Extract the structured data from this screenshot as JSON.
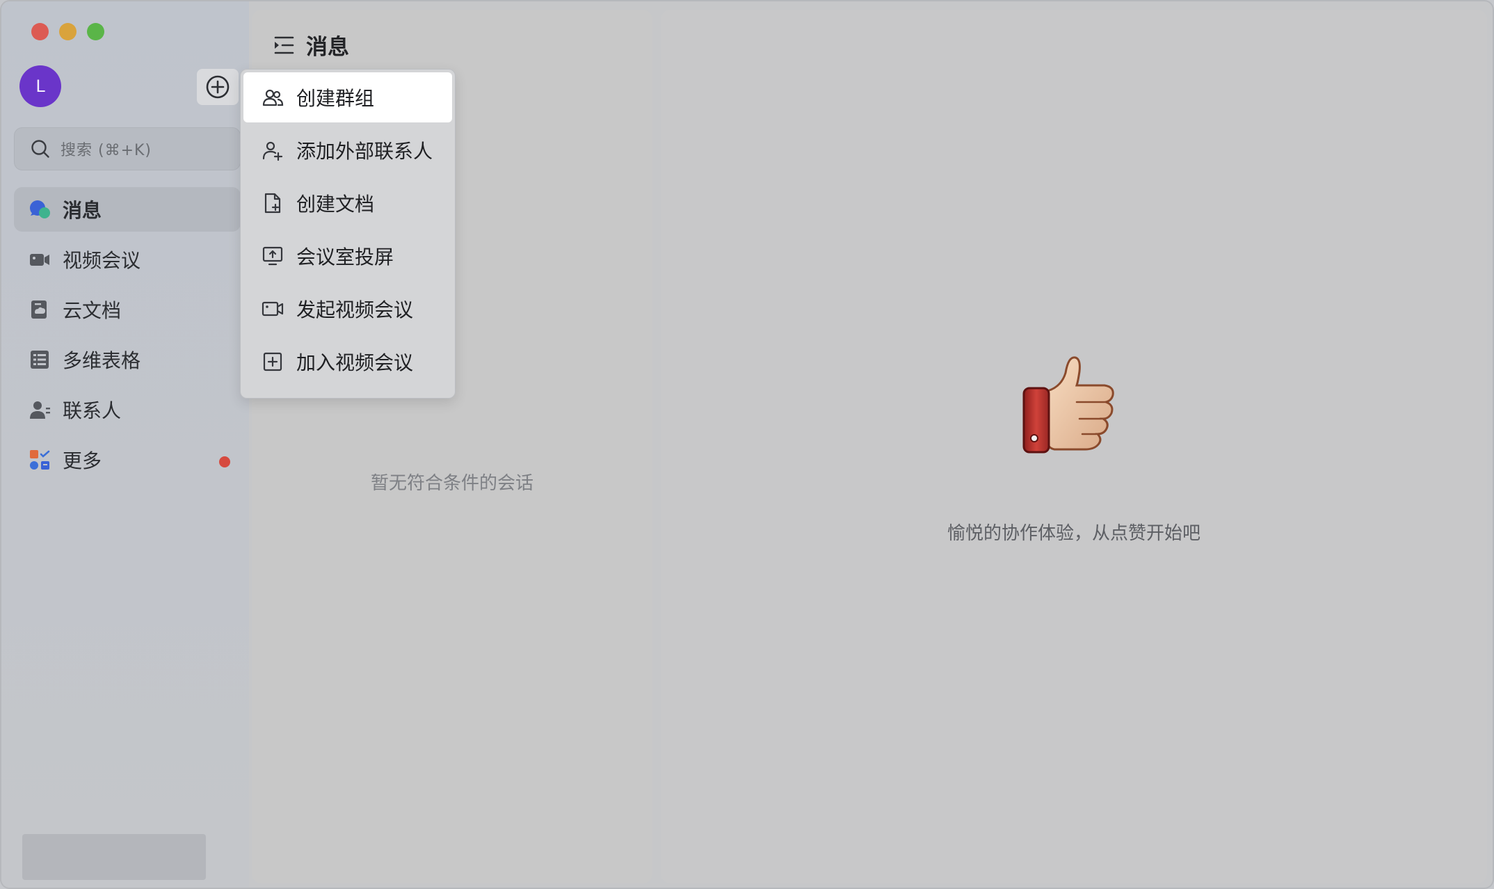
{
  "window": {
    "controls": [
      "close",
      "minimize",
      "zoom"
    ]
  },
  "sidebar": {
    "avatar_initial": "L",
    "add_icon": "plus-circle-icon",
    "search": {
      "placeholder": "搜索 (⌘+K)",
      "icon": "search-icon"
    },
    "items": [
      {
        "label": "消息",
        "icon": "chat-bubble-icon",
        "active": true
      },
      {
        "label": "视频会议",
        "icon": "video-camera-icon",
        "active": false
      },
      {
        "label": "云文档",
        "icon": "cloud-doc-icon",
        "active": false
      },
      {
        "label": "多维表格",
        "icon": "table-icon",
        "active": false
      },
      {
        "label": "联系人",
        "icon": "contacts-icon",
        "active": false
      },
      {
        "label": "更多",
        "icon": "apps-grid-icon",
        "active": false,
        "badge": "red-dot"
      }
    ]
  },
  "list_pane": {
    "title": "消息",
    "title_icon": "collapse-menu-icon",
    "empty_text": "暂无符合条件的会话"
  },
  "detail_pane": {
    "illustration": "thumbs-up-icon",
    "text": "愉悦的协作体验，从点赞开始吧"
  },
  "menu": {
    "items": [
      {
        "label": "创建群组",
        "icon": "group-icon",
        "highlight": true
      },
      {
        "label": "添加外部联系人",
        "icon": "add-contact-icon"
      },
      {
        "label": "创建文档",
        "icon": "new-document-icon"
      },
      {
        "label": "会议室投屏",
        "icon": "screen-share-icon"
      },
      {
        "label": "发起视频会议",
        "icon": "video-call-icon"
      },
      {
        "label": "加入视频会议",
        "icon": "join-meeting-icon"
      }
    ]
  },
  "colors": {
    "avatar": "#6a35c9",
    "badge": "#d64a3f",
    "close": "#dc5b53",
    "minimize": "#d9a33c",
    "zoom": "#5ab548"
  }
}
